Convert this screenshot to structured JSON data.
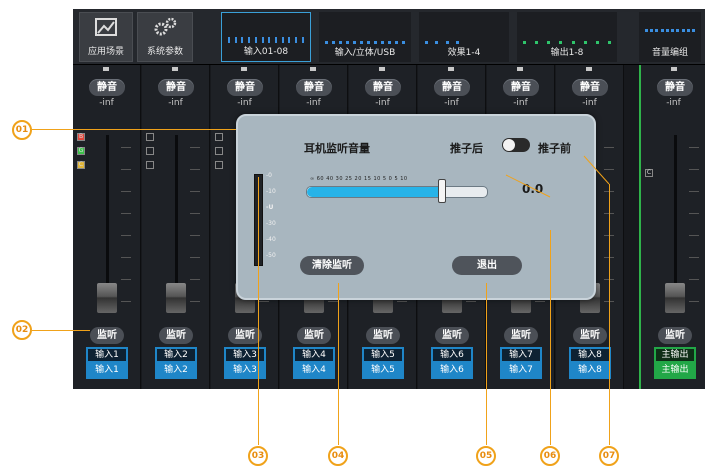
{
  "top_buttons": [
    {
      "label": "应用场景",
      "icon": "scene-icon"
    },
    {
      "label": "系统参数",
      "icon": "gear-icon"
    }
  ],
  "tabs": [
    {
      "label": "输入01-08",
      "active": true
    },
    {
      "label": "输入/立体/USB",
      "active": false
    },
    {
      "label": "效果1-4",
      "active": false
    },
    {
      "label": "输出1-8",
      "active": false
    },
    {
      "label": "音量编组",
      "active": false
    }
  ],
  "strip": {
    "mute_label": "静音",
    "level": "-inf",
    "monitor_label": "监听"
  },
  "channels": [
    {
      "top": "输入1",
      "bottom": "输入1"
    },
    {
      "top": "输入2",
      "bottom": "输入2"
    },
    {
      "top": "输入3",
      "bottom": "输入3"
    },
    {
      "top": "输入4",
      "bottom": "输入4"
    },
    {
      "top": "输入5",
      "bottom": "输入5"
    },
    {
      "top": "输入6",
      "bottom": "输入6"
    },
    {
      "top": "输入7",
      "bottom": "输入7"
    },
    {
      "top": "输入8",
      "bottom": "输入8"
    }
  ],
  "master": {
    "mute": "静音",
    "level": "-inf",
    "monitor": "监听",
    "top": "主输出",
    "bottom": "主输出"
  },
  "indicators": [
    "B",
    "G",
    "C"
  ],
  "dialog": {
    "title": "耳机监听音量",
    "post_label": "推子后",
    "pre_label": "推子前",
    "toggle_on": false,
    "meter_scale": [
      "-0",
      "-10",
      "-U",
      "-30",
      "-40",
      "-50"
    ],
    "slider_scale": "∞ 60 40 30   25   20   15   10   5   0   5   10",
    "slider_value": 0.75,
    "readout": "0.0",
    "clear_button": "清除监听",
    "exit_button": "退出"
  },
  "callouts": [
    "01",
    "02",
    "03",
    "04",
    "05",
    "06",
    "07"
  ],
  "colors": {
    "accent": "#1f86c8",
    "master": "#22a747",
    "callout": "#f0a21a",
    "slider_fill": "#27b3e8"
  }
}
